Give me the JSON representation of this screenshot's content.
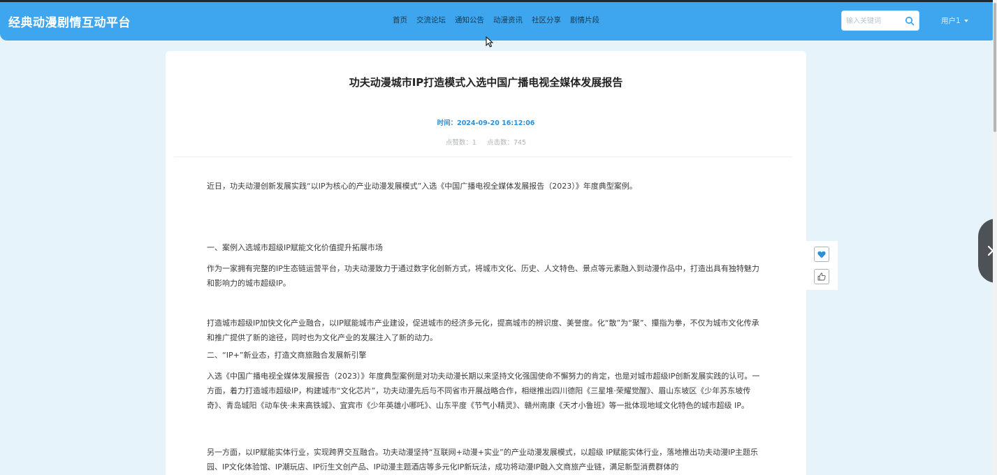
{
  "header": {
    "site_title": "经典动漫剧情互动平台",
    "nav": [
      "首页",
      "交流论坛",
      "通知公告",
      "动漫资讯",
      "社区分享",
      "剧情片段"
    ],
    "search_placeholder": "输入关键词",
    "user_label": "用户1"
  },
  "article": {
    "title": "功夫动漫城市IP打造模式入选中国广播电视全媒体发展报告",
    "time": "时间：2024-09-20 16:12:06",
    "likes": "点赞数：1",
    "clicks": "点击数：745",
    "paragraphs": [
      "近日，功夫动漫创新发展实践“以IP为核心的产业动漫发展模式”入选《中国广播电视全媒体发展报告（2023）》年度典型案例。",
      "一、案例入选城市超级IP赋能文化价值提升拓展市场",
      "作为一家拥有完整的IP生态链运营平台，功夫动漫致力于通过数字化创新方式，将城市文化、历史、人文特色、景点等元素融入到动漫作品中，打造出具有独特魅力和影响力的城市超级IP。",
      "打造城市超级IP加快文化产业融合，以IP赋能城市产业建设，促进城市的经济多元化，提高城市的辨识度、美誉度。化“散”为“聚”、攥指为拳，不仅为城市文化传承和推广提供了新的途径，同时也为文化产业的发展注入了新的动力。",
      "二、“IP+”新业态，打造文商旅融合发展新引擎",
      "入选《中国广播电视全媒体发展报告（2023）》年度典型案例是对功夫动漫长期以来坚持文化强国使命不懈努力的肯定，也是对城市超级IP创新发展实践的认可。一方面，着力打造城市超级IP，构建城市“文化芯片”，功夫动漫先后与不同省市开展战略合作，相继推出四川德阳《三星堆·荣耀觉醒》、眉山东坡区《少年苏东坡传奇》、青岛城阳《动车侠·未来高铁城》、宜宾市《少年英雄小哪吒》、山东平度《节气小精灵》、赣州南康《天才小鲁班》等一批体现地域文化特色的城市超级 IP。",
      "另一方面，以IP赋能实体行业，实现跨界交互融合。功夫动漫坚持“互联网+动漫+实业”的产业动漫发展模式，以超级 IP赋能实体行业，落地推出功夫动漫IP主题乐园、IP文化体验馆、IP潮玩店、IP衍生文创产品、IP动漫主题酒店等多元化IP新玩法，成功将动漫IP融入文商旅产业链，满足新型消费群体的"
    ]
  },
  "colors": {
    "header_bg": "#3ea6ee",
    "page_bg": "#e6f3fb",
    "accent": "#2d8fd6"
  },
  "icons": [
    "search-icon",
    "chevron-down-icon",
    "heart-icon",
    "thumbs-up-icon",
    "chevron-right-icon",
    "mouse-cursor-icon"
  ]
}
